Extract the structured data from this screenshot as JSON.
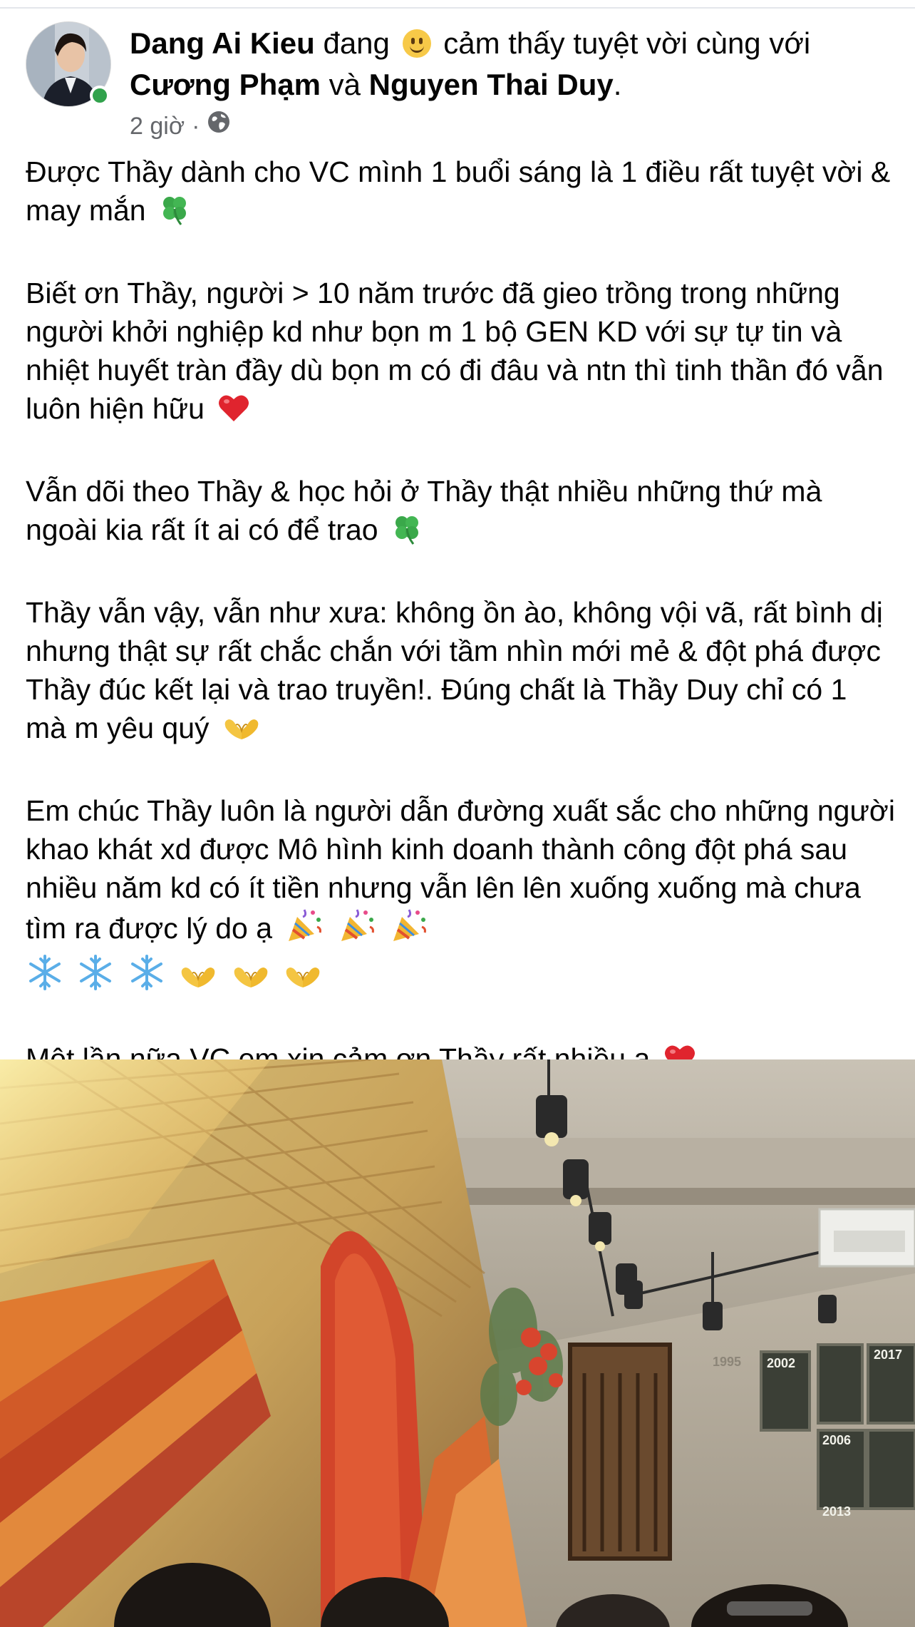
{
  "post": {
    "author": "Dang Ai Kieu",
    "feeling_prefix": "đang",
    "feeling_text": "cảm thấy tuyệt vời cùng với",
    "tagged_1": "Cương Phạm",
    "conjunction": "và",
    "tagged_2": "Nguyen Thai Duy",
    "end_punct": ".",
    "time": "2 giờ",
    "separator": "·",
    "privacy_icon": "globe-icon"
  },
  "body": {
    "p1": "Được Thầy dành cho VC mình 1 buổi sáng là 1 điều rất tuyệt vời & may mắn",
    "p2": "Biết ơn Thầy, người > 10 năm trước đã gieo trồng trong những người khởi nghiệp kd như bọn m 1 bộ GEN KD với sự tự tin và nhiệt huyết tràn đầy dù bọn m có đi đâu và ntn thì tinh thần đó vẫn luôn hiện hữu",
    "p3": "Vẫn dõi theo Thầy & học hỏi ở Thầy thật nhiều những thứ mà ngoài kia rất ít ai có để trao",
    "p4": "Thầy vẫn vậy, vẫn như xưa: không ồn ào, không vội vã, rất bình dị nhưng thật sự rất chắc chắn với tầm nhìn mới mẻ & đột phá được Thầy đúc kết lại và trao truyền!. Đúng chất là Thầy Duy chỉ có 1 mà m yêu quý",
    "p5": "Em chúc Thầy luôn là người dẫn đường xuất sắc cho những người khao khát xd được Mô hình kinh doanh thành công đột phá sau nhiều năm kd có ít tiền nhưng vẫn lên lên xuống xuống mà chưa tìm ra được lý do ạ",
    "p6": "Một lần nữa VC em xin cảm ơn Thầy rất nhiều ạ"
  },
  "emoji": {
    "clover": "four-leaf-clover-icon",
    "heart": "red-heart-icon",
    "heart_hands": "heart-hands-icon",
    "party": "party-popper-icon",
    "snowflake": "snowflake-icon",
    "smile": "smiling-face-icon"
  },
  "photo": {
    "frames": [
      "1995",
      "2002",
      "2006",
      "2013",
      "2017"
    ]
  },
  "colors": {
    "text": "#050505",
    "meta": "#65676b",
    "online": "#31a24c",
    "heart": "#e0242e",
    "clover": "#3aa84a"
  }
}
